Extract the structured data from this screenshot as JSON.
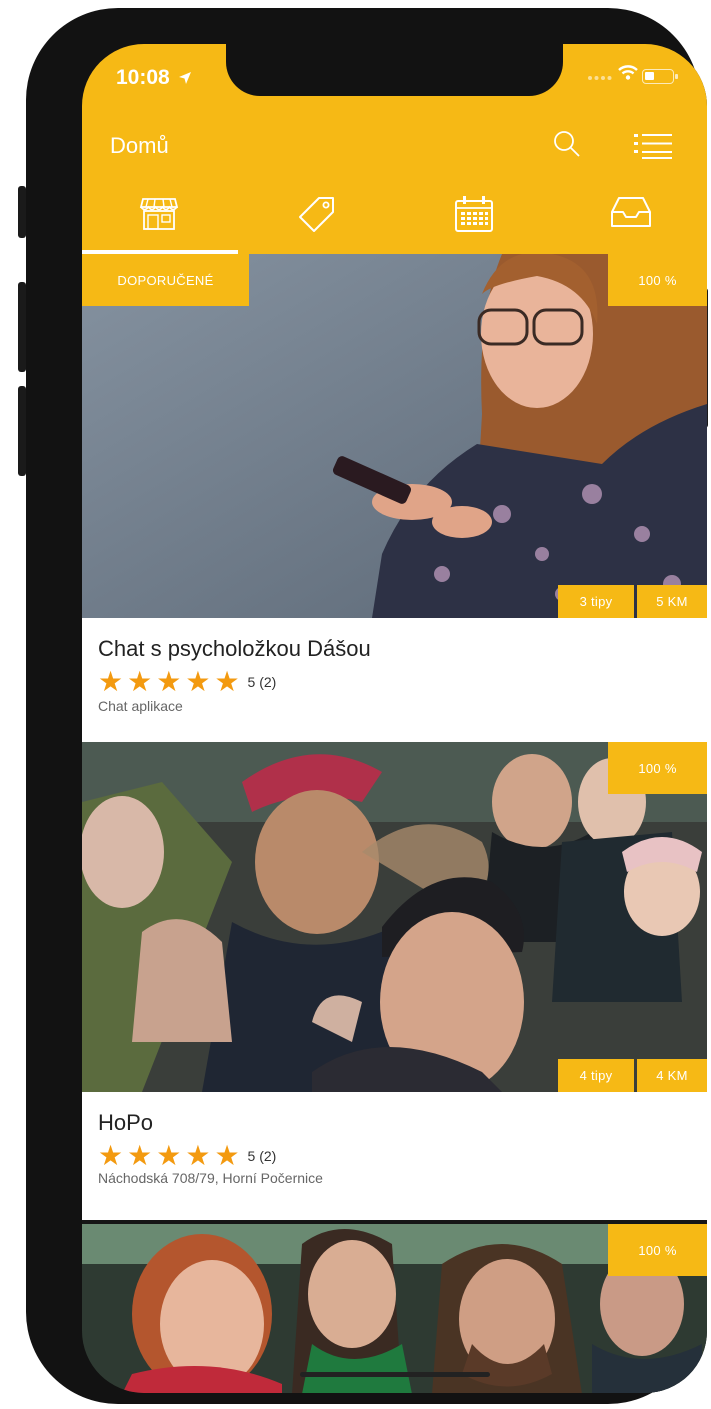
{
  "status_bar": {
    "time": "10:08"
  },
  "header": {
    "title": "Domů"
  },
  "tabs": [
    {
      "name": "tab-shops",
      "icon": "storefront-icon",
      "active": true
    },
    {
      "name": "tab-deals",
      "icon": "tag-icon",
      "active": false
    },
    {
      "name": "tab-calendar",
      "icon": "calendar-icon",
      "active": false
    },
    {
      "name": "tab-inbox",
      "icon": "inbox-icon",
      "active": false
    }
  ],
  "cards": [
    {
      "featured_label": "DOPORUČENÉ",
      "match": "100 %",
      "tips": "3 tipy",
      "distance": "5 KM",
      "name": "Chat s psycholožkou Dášou",
      "stars": 5,
      "rating": "5 (2)",
      "subtitle": "Chat aplikace"
    },
    {
      "match": "100 %",
      "tips": "4 tipy",
      "distance": "4 KM",
      "name": "HoPo",
      "stars": 5,
      "rating": "5 (2)",
      "subtitle": "Náchodská 708/79, Horní Počernice"
    },
    {
      "match": "100 %"
    }
  ],
  "colors": {
    "accent": "#f6b915",
    "star": "#f39a10",
    "frame": "#121212"
  }
}
